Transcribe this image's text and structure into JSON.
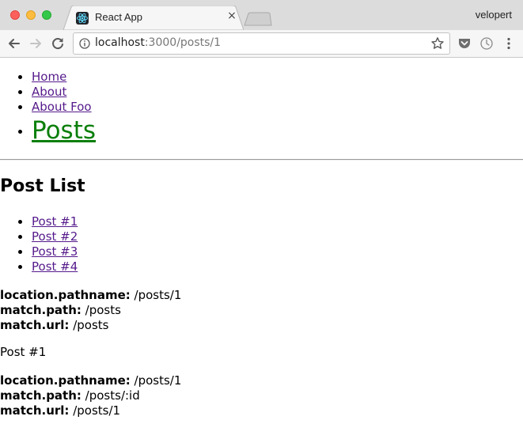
{
  "browser": {
    "tab_title": "React App",
    "tab_close": "×",
    "profile_name": "velopert",
    "url_host": "localhost",
    "url_rest": ":3000/posts/1"
  },
  "nav": {
    "items": [
      {
        "label": "Home"
      },
      {
        "label": "About"
      },
      {
        "label": "About Foo"
      },
      {
        "label": "Posts",
        "active": true
      }
    ],
    "active_color": "#0b7f0b"
  },
  "page": {
    "heading": "Post List",
    "posts": [
      {
        "label": "Post #1"
      },
      {
        "label": "Post #2"
      },
      {
        "label": "Post #3"
      },
      {
        "label": "Post #4"
      }
    ],
    "outer_info": {
      "pathname_label": "location.pathname:",
      "pathname_value": " /posts/1",
      "path_label": "match.path:",
      "path_value": " /posts",
      "url_label": "match.url:",
      "url_value": " /posts"
    },
    "post_title": "Post #1",
    "inner_info": {
      "pathname_label": "location.pathname:",
      "pathname_value": " /posts/1",
      "path_label": "match.path:",
      "path_value": " /posts/:id",
      "url_label": "match.url:",
      "url_value": " /posts/1"
    }
  },
  "icons": {
    "back": "arrow-left-icon",
    "forward": "arrow-right-icon",
    "reload": "reload-icon",
    "info": "info-icon",
    "star": "star-icon",
    "pocket": "pocket-icon",
    "timer": "timer-icon",
    "menu": "kebab-menu-icon",
    "favicon": "react-icon"
  }
}
